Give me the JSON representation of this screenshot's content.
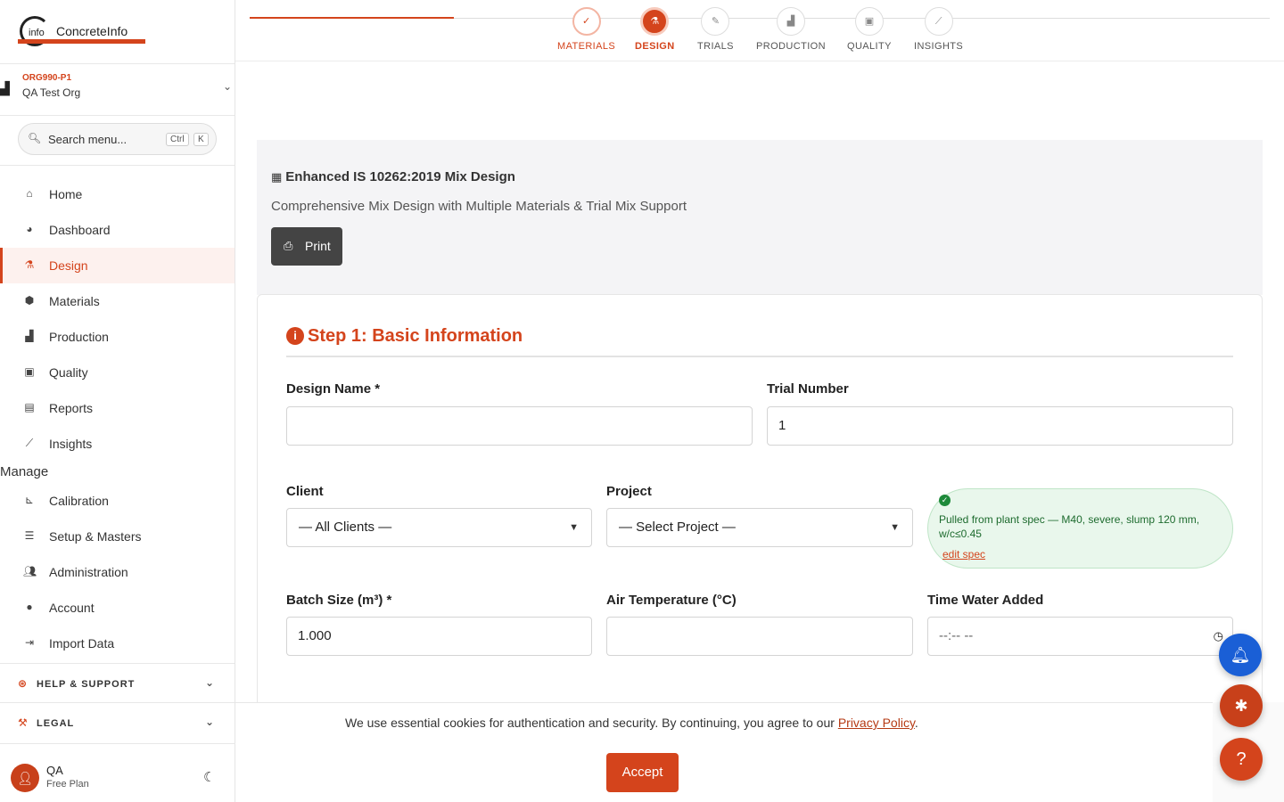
{
  "brand": {
    "name": "ConcreteInfo",
    "mark": "info",
    "accent": "#d4441c"
  },
  "org": {
    "code": "ORG990-P1",
    "name": "QA Test Org"
  },
  "search": {
    "placeholder": "Search menu...",
    "kbd1": "Ctrl",
    "kbd2": "K"
  },
  "sidebar": {
    "items": [
      {
        "label": "Home",
        "icon": "home-icon"
      },
      {
        "label": "Dashboard",
        "icon": "pie-chart-icon"
      },
      {
        "label": "Design",
        "icon": "flask-icon",
        "active": true
      },
      {
        "label": "Materials",
        "icon": "cubes-icon"
      },
      {
        "label": "Production",
        "icon": "industry-icon"
      },
      {
        "label": "Quality",
        "icon": "clipboard-check-icon"
      },
      {
        "label": "Reports",
        "icon": "file-icon"
      },
      {
        "label": "Insights",
        "icon": "line-chart-icon"
      }
    ],
    "manage_label": "Manage",
    "manage_items": [
      {
        "label": "Calibration",
        "icon": "ruler-icon"
      },
      {
        "label": "Setup & Masters",
        "icon": "sliders-icon"
      },
      {
        "label": "Administration",
        "icon": "users-icon"
      },
      {
        "label": "Account",
        "icon": "user-circle-icon"
      },
      {
        "label": "Import Data",
        "icon": "file-import-icon"
      }
    ],
    "help": "HELP & SUPPORT",
    "legal": "LEGAL"
  },
  "user": {
    "initial": "",
    "name": "QA",
    "plan": "Free Plan"
  },
  "stepper": {
    "steps": [
      {
        "label": "MATERIALS",
        "state": "done"
      },
      {
        "label": "DESIGN",
        "state": "current"
      },
      {
        "label": "TRIALS",
        "state": "todo"
      },
      {
        "label": "PRODUCTION",
        "state": "todo"
      },
      {
        "label": "QUALITY",
        "state": "todo"
      },
      {
        "label": "INSIGHTS",
        "state": "todo"
      }
    ]
  },
  "hero": {
    "title": "Enhanced IS 10262:2019 Mix Design",
    "subtitle": "Comprehensive Mix Design with Multiple Materials & Trial Mix Support",
    "print_label": "Print"
  },
  "form": {
    "step_title": "Step 1: Basic Information",
    "design_name_label": "Design Name *",
    "design_name_value": "",
    "trial_number_label": "Trial Number",
    "trial_number_value": "1",
    "client_label": "Client",
    "client_value": "— All Clients —",
    "project_label": "Project",
    "project_value": "— Select Project —",
    "spec_text": "Pulled from plant spec — M40, severe, slump 120 mm, w/c≤0.45",
    "spec_edit": "edit spec",
    "batch_label": "Batch Size (m³) *",
    "batch_value": "1.000",
    "air_temp_label": "Air Temperature (°C)",
    "air_temp_value": "",
    "time_water_label": "Time Water Added",
    "time_water_value": "--:-- --"
  },
  "cookie": {
    "message": "We use essential cookies for authentication and security. By continuing, you agree to our ",
    "link": "Privacy Policy",
    "end": ".",
    "accept": "Accept"
  },
  "fabs": {
    "help": "?",
    "colors": {
      "bell": "#1a5fd6",
      "bug": "#c8401a",
      "help": "#d4441c"
    }
  }
}
